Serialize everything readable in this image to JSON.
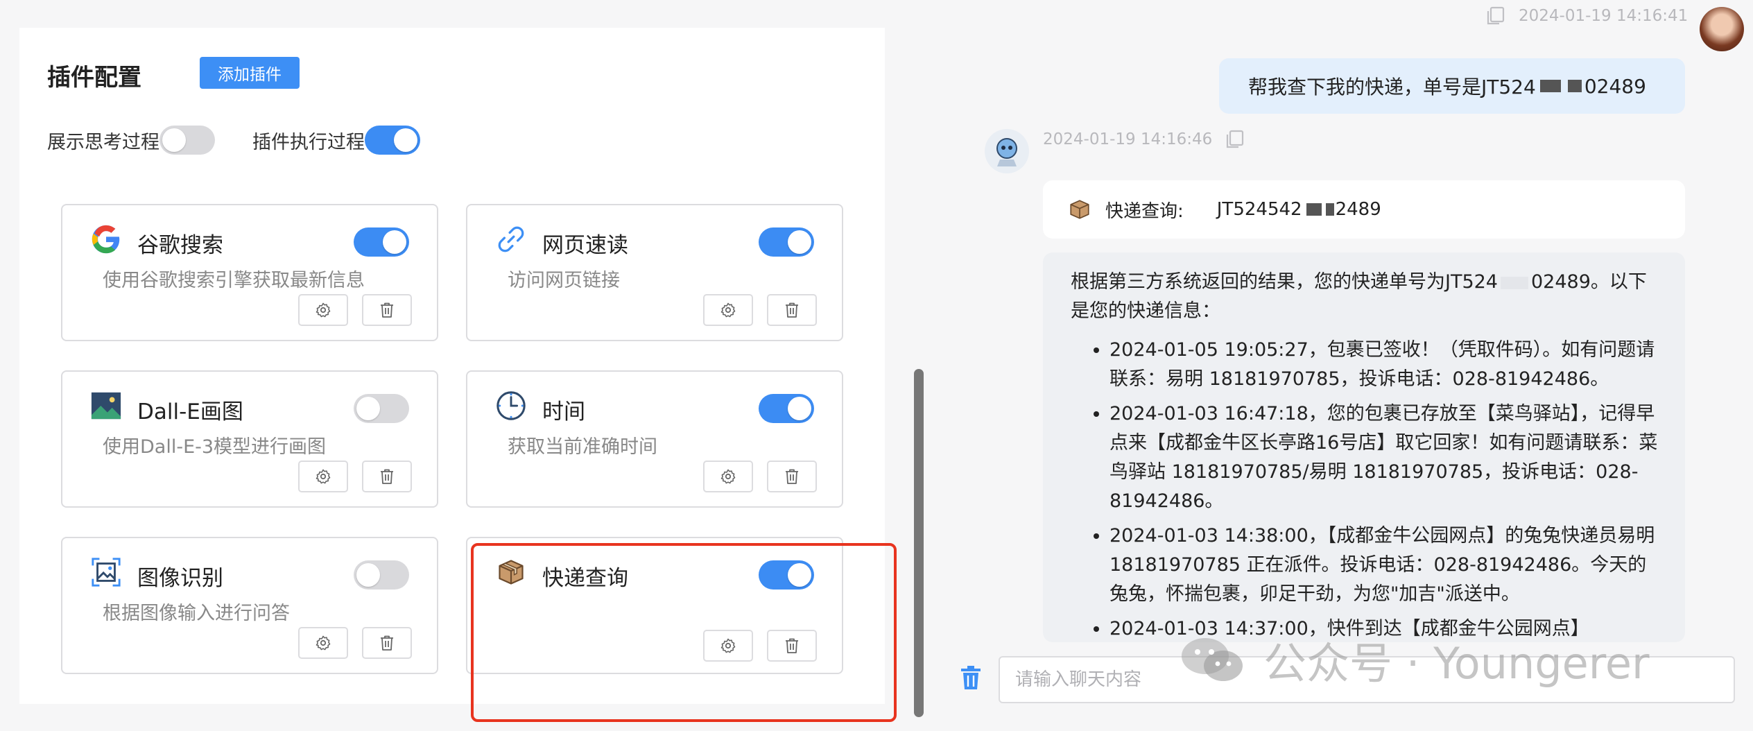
{
  "left": {
    "title": "插件配置",
    "add_button": "添加插件",
    "show_thinking_label": "展示思考过程",
    "show_thinking_on": false,
    "plugin_exec_label": "插件执行过程",
    "plugin_exec_on": true,
    "plugins": [
      {
        "name": "谷歌搜索",
        "desc": "使用谷歌搜索引擎获取最新信息",
        "enabled": true,
        "icon": "google-icon"
      },
      {
        "name": "网页速读",
        "desc": "访问网页链接",
        "enabled": true,
        "icon": "link-icon"
      },
      {
        "name": "Dall-E画图",
        "desc": "使用Dall-E-3模型进行画图",
        "enabled": false,
        "icon": "image-icon"
      },
      {
        "name": "时间",
        "desc": "获取当前准确时间",
        "enabled": true,
        "icon": "clock-icon"
      },
      {
        "name": "图像识别",
        "desc": "根据图像输入进行问答",
        "enabled": false,
        "icon": "scan-image-icon"
      },
      {
        "name": "快递查询",
        "desc": "",
        "enabled": true,
        "icon": "package-icon"
      }
    ],
    "colors": {
      "accent": "#3c8cf3",
      "highlight": "#e8341f"
    }
  },
  "chat": {
    "user_time": "2024-01-19 14:16:41",
    "user_message_a": "帮我查下我的快递，单号是JT524",
    "user_message_b": "02489",
    "bot_time": "2024-01-19 14:16:46",
    "tool_name": "快递查询:",
    "tool_value_a": "JT524542",
    "tool_value_b": "2489",
    "answer_intro": "根据第三方系统返回的结果，您的快递单号为JT524",
    "answer_intro_end": "02489。以下是您的快递信息：",
    "answer_items": [
      "2024-01-05 19:05:27，包裹已签收！（凭取件码）。如有问题请联系：易明 18181970785，投诉电话：028-81942486。",
      "2024-01-03 16:47:18，您的包裹已存放至【菜鸟驿站】，记得早点来【成都金牛区长亭路16号店】取它回家！如有问题请联系：菜鸟驿站 18181970785/易明 18181970785，投诉电话：028-81942486。",
      "2024-01-03 14:38:00，【成都金牛公园网点】的兔兔快递员易明 18181970785 正在派件。投诉电话：028-81942486。今天的兔兔，怀揣包裹，卯足干劲，为您\"加吉\"派送中。",
      "2024-01-03 14:37:00，快件到达【成都金牛公园网点】"
    ],
    "input_placeholder": "请输入聊天内容"
  },
  "watermark": "公众号 · Youngerer"
}
